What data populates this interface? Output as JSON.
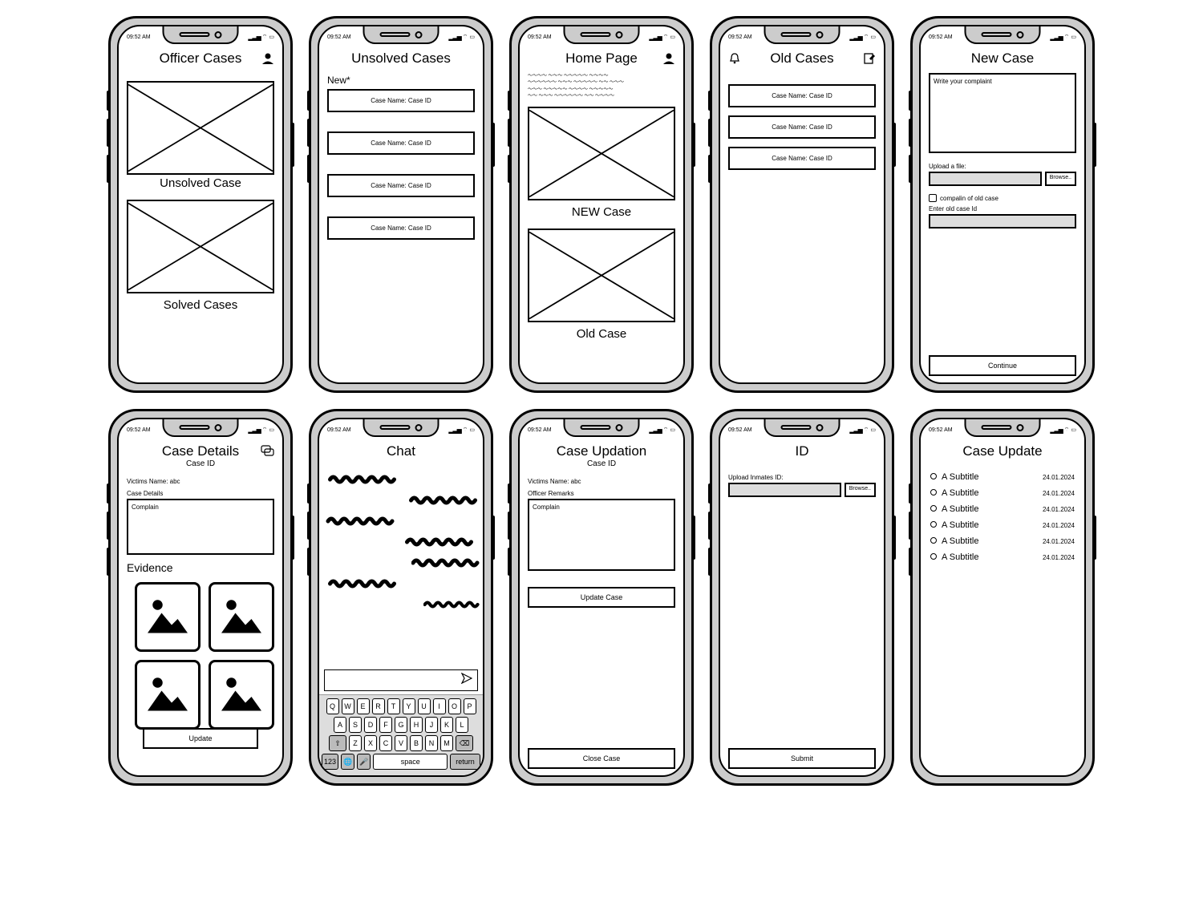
{
  "status": {
    "time": "09:52 AM",
    "signal": "▂▃▅",
    "wifi": "⌔",
    "batt": "▭"
  },
  "screens": {
    "officer": {
      "title": "Officer Cases",
      "unsolved": "Unsolved Case",
      "solved": "Solved Cases"
    },
    "unsolved": {
      "title": "Unsolved Cases",
      "new": "New*",
      "item": "Case Name: Case ID"
    },
    "home": {
      "title": "Home Page",
      "new": "NEW Case",
      "old": "Old Case"
    },
    "old": {
      "title": "Old Cases",
      "item": "Case Name:  Case ID"
    },
    "newcase": {
      "title": "New Case",
      "complaint_ph": "Write your complaint",
      "upload": "Upload a file:",
      "browse": "Browse..",
      "checkbox": "compalin of old case",
      "old_id": "Enter old case Id",
      "continue": "Continue"
    },
    "details": {
      "title": "Case Details",
      "sub": "Case ID",
      "victim": "Victims Name: abc",
      "cd_label": "Case Details",
      "complain": "Complain",
      "evidence": "Evidence",
      "update": "Update"
    },
    "chat": {
      "title": "Chat",
      "space": "space",
      "ret": "return",
      "num": "123"
    },
    "updation": {
      "title": "Case Updation",
      "sub": "Case ID",
      "victim": "Victims Name: abc",
      "remarks": "Officer Remarks",
      "complain": "Complain",
      "update": "Update Case",
      "close": "Close Case"
    },
    "id": {
      "title": "ID",
      "upload": "Upload Inmates ID:",
      "browse": "Browse..",
      "submit": "Submit"
    },
    "updates": {
      "title": "Case Update",
      "item": "A Subtitle",
      "date": "24.01.2024"
    }
  },
  "keyboard": {
    "r1": [
      "Q",
      "W",
      "E",
      "R",
      "T",
      "Y",
      "U",
      "I",
      "O",
      "P"
    ],
    "r2": [
      "A",
      "S",
      "D",
      "F",
      "G",
      "H",
      "J",
      "K",
      "L"
    ],
    "r3": [
      "⇧",
      "Z",
      "X",
      "C",
      "V",
      "B",
      "N",
      "M",
      "⌫"
    ],
    "r4": [
      "123",
      "🌐",
      "🎤",
      "space",
      "return"
    ]
  }
}
